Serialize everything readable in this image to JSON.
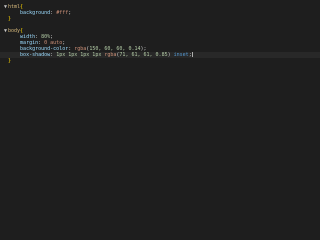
{
  "editor": {
    "lines": [
      {
        "indent": "",
        "tokens": [
          {
            "t": "html",
            "c": "c-sel"
          },
          {
            "t": "{",
            "c": "c-brace"
          }
        ],
        "fold": "▼"
      },
      {
        "indent": "    ",
        "tokens": [
          {
            "t": "background",
            "c": "c-prop"
          },
          {
            "t": ": ",
            "c": "c-punct"
          },
          {
            "t": "#fff",
            "c": "c-val"
          },
          {
            "t": ";",
            "c": "c-punct"
          }
        ]
      },
      {
        "indent": "",
        "tokens": [
          {
            "t": "}",
            "c": "c-brace"
          }
        ]
      },
      {
        "indent": "",
        "tokens": []
      },
      {
        "indent": "",
        "tokens": [
          {
            "t": "body",
            "c": "c-sel"
          },
          {
            "t": "{",
            "c": "c-brace"
          }
        ],
        "fold": "▼"
      },
      {
        "indent": "    ",
        "tokens": [
          {
            "t": "width",
            "c": "c-prop"
          },
          {
            "t": ": ",
            "c": "c-punct"
          },
          {
            "t": "80%",
            "c": "c-num"
          },
          {
            "t": ";",
            "c": "c-punct"
          }
        ]
      },
      {
        "indent": "    ",
        "tokens": [
          {
            "t": "margin",
            "c": "c-prop"
          },
          {
            "t": ": ",
            "c": "c-punct"
          },
          {
            "t": "0 auto",
            "c": "c-val"
          },
          {
            "t": ";",
            "c": "c-punct"
          }
        ]
      },
      {
        "indent": "    ",
        "tokens": [
          {
            "t": "background-color",
            "c": "c-prop"
          },
          {
            "t": ": ",
            "c": "c-punct"
          },
          {
            "t": "rgba",
            "c": "c-val"
          },
          {
            "t": "(",
            "c": "c-punct"
          },
          {
            "t": "150, 60, 60, 0.14",
            "c": "c-num"
          },
          {
            "t": ");",
            "c": "c-punct"
          }
        ]
      },
      {
        "indent": "    ",
        "tokens": [
          {
            "t": "box-shadow",
            "c": "c-prop"
          },
          {
            "t": ": ",
            "c": "c-punct"
          },
          {
            "t": "1px 1px 1px 1px",
            "c": "c-num"
          },
          {
            "t": " ",
            "c": "c-punct"
          },
          {
            "t": "rgba",
            "c": "c-val"
          },
          {
            "t": "(",
            "c": "c-punct"
          },
          {
            "t": "71, 61, 61, 0.85",
            "c": "c-num"
          },
          {
            "t": ") ",
            "c": "c-punct"
          },
          {
            "t": "inset",
            "c": "c-kw"
          },
          {
            "t": ";",
            "c": "c-punct"
          }
        ],
        "current": true
      },
      {
        "indent": "",
        "tokens": [
          {
            "t": "}",
            "c": "c-brace"
          }
        ]
      }
    ]
  }
}
